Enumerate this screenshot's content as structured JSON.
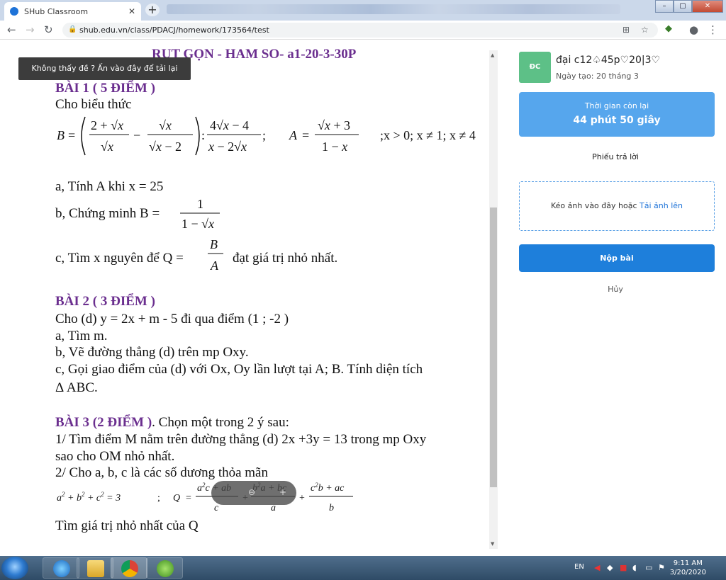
{
  "browser": {
    "tab_title": "SHub Classroom",
    "tab_close": "✕",
    "new_tab": "+",
    "url": "shub.edu.vn/class/PDACJ/homework/173564/test",
    "window_buttons": [
      "–",
      "▢",
      "✕"
    ]
  },
  "doc": {
    "title": "RUT GỌN - HAM SO- a1-20-3-30P",
    "tooltip": "Không thấy đề ? Ấn vào đây để tải lại",
    "bai1": {
      "heading": "BÀI 1 ( 5 ĐIỂM )",
      "intro": "Cho biểu thức",
      "condition": ";x > 0; x ≠ 1; x ≠ 4",
      "qa": "a, Tính A khi x = 25",
      "qb": "b, Chứng minh B =",
      "qc_prefix": "c, Tìm x nguyên để Q =",
      "qc_suffix": "đạt giá trị nhỏ nhất."
    },
    "bai2": {
      "heading": "BÀI 2 ( 3 ĐIỂM )",
      "lines": [
        "Cho (d) y = 2x + m - 5 đi qua điểm (1 ; -2 )",
        "a, Tìm m.",
        "b, Vẽ đường thẳng (d) trên mp Oxy.",
        "c, Gọi giao điểm của (d) với Ox, Oy lần lượt tại A; B. Tính diện tích",
        "Δ ABC."
      ]
    },
    "bai3": {
      "heading": "BÀI 3 (2 ĐIỂM )",
      "heading_tail": ". Chọn một trong 2 ý sau:",
      "lines": [
        "1/ Tìm điểm M nằm trên đường thẳng (d) 2x +3y = 13 trong mp Oxy",
        "sao cho OM nhỏ nhất.",
        "2/ Cho a, b, c là các số dương thỏa mãn"
      ],
      "last": "Tìm giá trị nhỏ nhất của Q"
    }
  },
  "sidebar": {
    "avatar": "ĐC",
    "name": "đại c12♤45p♡20|3♡",
    "created": "Ngày tạo: 20 tháng 3",
    "timer_label": "Thời gian còn lại",
    "timer_value": "44 phút 50 giây",
    "answer_sheet": "Phiếu trả lời",
    "drop_text": "Kéo ảnh vào đây hoặc",
    "upload_link": "Tải ảnh lên",
    "submit": "Nộp bài",
    "cancel": "Hủy"
  },
  "taskbar": {
    "lang": "EN",
    "time": "9:11 AM",
    "date": "3/20/2020"
  }
}
